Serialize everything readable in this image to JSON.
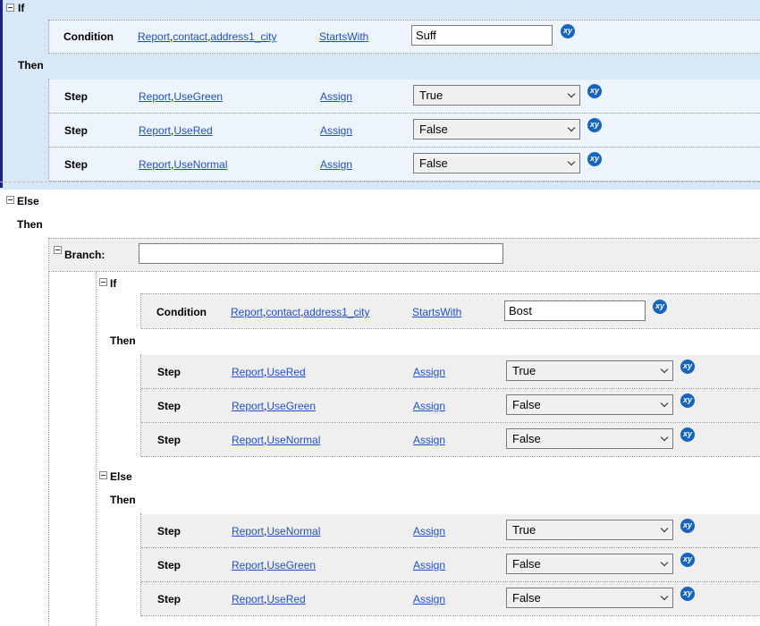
{
  "keywords": {
    "if": "If",
    "then": "Then",
    "else": "Else",
    "branch": "Branch:",
    "condition": "Condition",
    "step": "Step"
  },
  "field_parts": {
    "report": "Report",
    "contact": "contact",
    "address1_city": "address1_city",
    "use_green": "UseGreen",
    "use_red": "UseRed",
    "use_normal": "UseNormal"
  },
  "operators": {
    "starts_with": "StartsWith",
    "assign": "Assign"
  },
  "outer": {
    "condition_value": "Suff",
    "then_steps": [
      {
        "field": "UseGreen",
        "value": "True"
      },
      {
        "field": "UseRed",
        "value": "False"
      },
      {
        "field": "UseNormal",
        "value": "False"
      }
    ]
  },
  "branch": {
    "name_value": "",
    "condition_value": "Bost",
    "then_steps": [
      {
        "field": "UseRed",
        "value": "True"
      },
      {
        "field": "UseGreen",
        "value": "False"
      },
      {
        "field": "UseNormal",
        "value": "False"
      }
    ],
    "else_steps": [
      {
        "field": "UseNormal",
        "value": "True"
      },
      {
        "field": "UseGreen",
        "value": "False"
      },
      {
        "field": "UseRed",
        "value": "False"
      }
    ]
  },
  "variable_icon_label": "xy",
  "colors": {
    "selection_band": "#d9e8f8",
    "selection_bar": "#1a237e",
    "link": "#1f4fc8",
    "variable_icon": "#1565c0"
  }
}
